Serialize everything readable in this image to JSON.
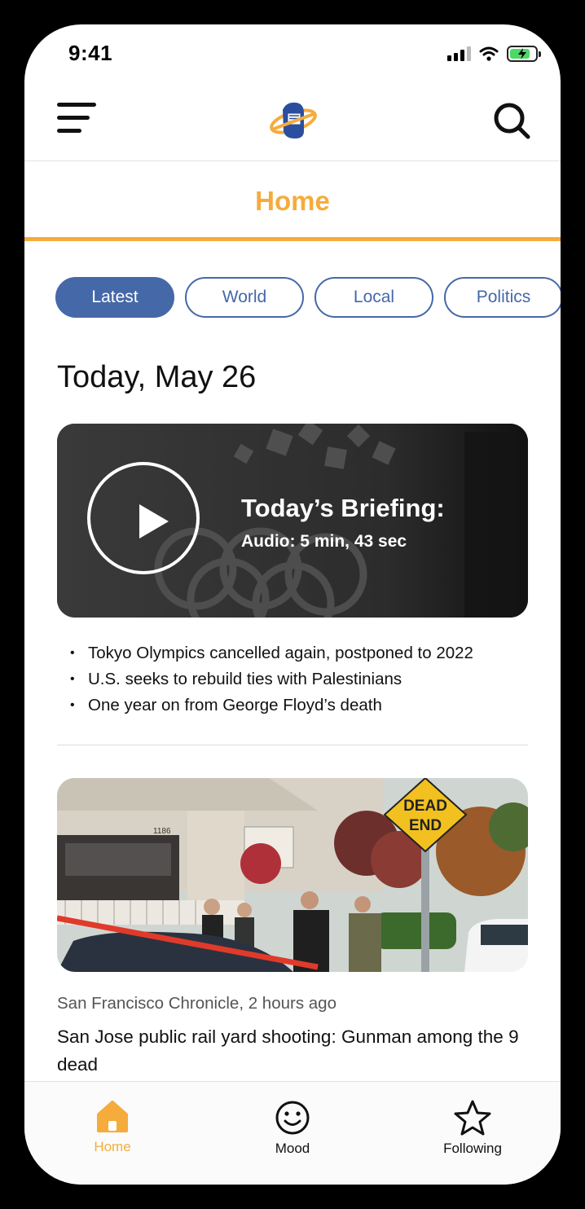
{
  "status": {
    "time": "9:41"
  },
  "header": {
    "title": "Home"
  },
  "tabs": [
    {
      "label": "Latest",
      "active": true
    },
    {
      "label": "World",
      "active": false
    },
    {
      "label": "Local",
      "active": false
    },
    {
      "label": "Politics",
      "active": false
    }
  ],
  "date_heading": "Today, May 26",
  "briefing": {
    "title": "Today’s Briefing:",
    "subtitle": "Audio: 5 min, 43 sec",
    "bullets": [
      "Tokyo Olympics cancelled again, postponed to 2022",
      "U.S. seeks to rebuild ties with Palestinians",
      "One year on from George Floyd’s death"
    ]
  },
  "article": {
    "source": "San Francisco Chronicle, 2 hours ago",
    "headline": "San Jose public rail yard shooting: Gunman among the 9 dead",
    "house_number": "1186",
    "sign_text": [
      "DEAD",
      "END"
    ]
  },
  "nav": [
    {
      "label": "Home",
      "icon": "home-icon",
      "active": true
    },
    {
      "label": "Mood",
      "icon": "smiley-icon",
      "active": false
    },
    {
      "label": "Following",
      "icon": "star-icon",
      "active": false
    }
  ],
  "colors": {
    "accent": "#f5ac3c",
    "primary": "#4568a8"
  }
}
